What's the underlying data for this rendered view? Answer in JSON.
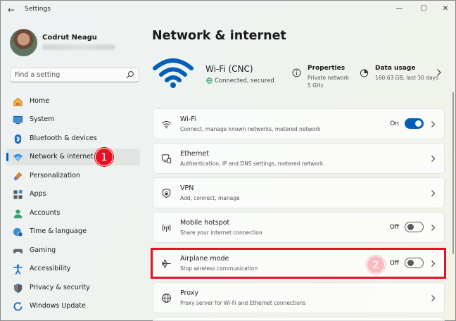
{
  "window": {
    "title": "Settings",
    "back_glyph": "←",
    "minimize_glyph": "—",
    "maximize_glyph": "☐",
    "close_glyph": "✕"
  },
  "user": {
    "name": "Codrut Neagu"
  },
  "search": {
    "placeholder": "Find a setting",
    "icon": "search-icon"
  },
  "sidebar": {
    "items": [
      {
        "label": "Home",
        "icon": "home-icon",
        "selected": false
      },
      {
        "label": "System",
        "icon": "monitor-icon",
        "selected": false
      },
      {
        "label": "Bluetooth & devices",
        "icon": "bluetooth-icon",
        "selected": false
      },
      {
        "label": "Network & internet",
        "icon": "network-icon",
        "selected": true
      },
      {
        "label": "Personalization",
        "icon": "brush-icon",
        "selected": false
      },
      {
        "label": "Apps",
        "icon": "apps-icon",
        "selected": false
      },
      {
        "label": "Accounts",
        "icon": "person-icon",
        "selected": false
      },
      {
        "label": "Time & language",
        "icon": "globe-clock-icon",
        "selected": false
      },
      {
        "label": "Gaming",
        "icon": "gamepad-icon",
        "selected": false
      },
      {
        "label": "Accessibility",
        "icon": "accessibility-icon",
        "selected": false
      },
      {
        "label": "Privacy & security",
        "icon": "shield-icon",
        "selected": false
      },
      {
        "label": "Windows Update",
        "icon": "update-icon",
        "selected": false
      }
    ]
  },
  "markers": {
    "one": "1",
    "two": "2"
  },
  "page": {
    "title": "Network & internet"
  },
  "connection": {
    "name": "Wi-Fi (CNC)",
    "status": "Connected, secured",
    "properties": {
      "title": "Properties",
      "line1": "Private network",
      "line2": "5 GHz"
    },
    "data_usage": {
      "title": "Data usage",
      "detail": "160.63 GB, last 30 days"
    }
  },
  "cards": [
    {
      "title": "Wi-Fi",
      "subtitle": "Connect, manage known networks, metered network",
      "icon": "wifi-icon",
      "toggle": "On"
    },
    {
      "title": "Ethernet",
      "subtitle": "Authentication, IP and DNS settings, metered network",
      "icon": "ethernet-icon",
      "toggle": null
    },
    {
      "title": "VPN",
      "subtitle": "Add, connect, manage",
      "icon": "vpn-shield-icon",
      "toggle": null
    },
    {
      "title": "Mobile hotspot",
      "subtitle": "Share your internet connection",
      "icon": "hotspot-icon",
      "toggle": "Off"
    },
    {
      "title": "Airplane mode",
      "subtitle": "Stop wireless communication",
      "icon": "airplane-icon",
      "toggle": "Off"
    },
    {
      "title": "Proxy",
      "subtitle": "Proxy server for Wi-Fi and Ethernet connections",
      "icon": "globe-icon",
      "toggle": null
    }
  ],
  "colors": {
    "accent": "#005fb8",
    "marker": "#e81123",
    "highlight": "#e81123"
  }
}
